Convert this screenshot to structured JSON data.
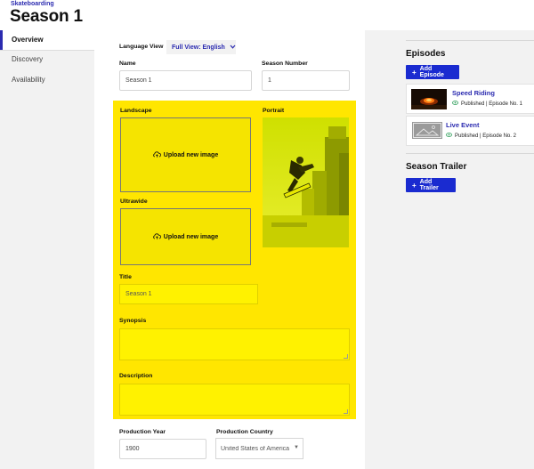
{
  "header": {
    "breadcrumb": "Skateboarding",
    "title": "Season 1"
  },
  "sidebar": {
    "items": [
      {
        "label": "Overview",
        "active": true
      },
      {
        "label": "Discovery"
      },
      {
        "label": "Availability"
      }
    ]
  },
  "form": {
    "language_view_label": "Language View",
    "language_view_value": "Full View: English",
    "name_label": "Name",
    "name_value": "Season 1",
    "season_number_label": "Season Number",
    "season_number_value": "1",
    "landscape_label": "Landscape",
    "portrait_label": "Portrait",
    "ultrawide_label": "Ultrawide",
    "upload_label": "Upload new image",
    "title_label": "Title",
    "title_value": "Season 1",
    "synopsis_label": "Synopsis",
    "description_label": "Description",
    "production_year_label": "Production Year",
    "production_year_value": "1900",
    "production_country_label": "Production Country",
    "production_country_value": "United States of America"
  },
  "episodes": {
    "heading": "Episodes",
    "add_label": "Add Episode",
    "items": [
      {
        "title": "Speed Riding",
        "status": "Published | Episode No. 1"
      },
      {
        "title": "Live Event",
        "status": "Published | Episode No. 2"
      }
    ]
  },
  "trailer": {
    "heading": "Season Trailer",
    "add_label": "Add Trailer"
  },
  "colors": {
    "accent": "#2b2bb0",
    "button": "#1a2bd0",
    "highlight": "#ffe600",
    "published": "#2e9e5a"
  }
}
